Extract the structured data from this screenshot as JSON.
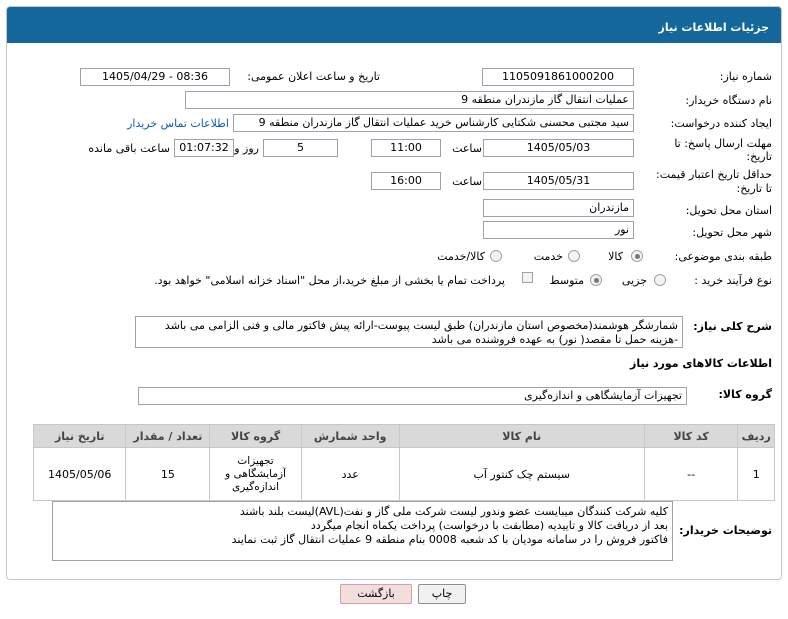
{
  "header": {
    "title": "جزئیات اطلاعات نیاز"
  },
  "form": {
    "need_number_label": "شماره نیاز:",
    "need_number": "1105091861000200",
    "announce_label": "تاریخ و ساعت اعلان عمومی:",
    "announce_value": "1405/04/29 - 08:36",
    "buyer_org_label": "نام دستگاه خریدار:",
    "buyer_org": "عملیات انتقال گاز مازندران منطقه 9",
    "requester_label": "ایجاد کننده درخواست:",
    "requester": "سید مجتبی محسنی شکتایی کارشناس خرید عملیات انتقال گاز مازندران منطقه 9",
    "contact_link": "اطلاعات تماس خریدار",
    "deadline_label_1": "مهلت ارسال پاسخ: تا",
    "deadline_label_2": "تاریخ:",
    "deadline_date": "1405/05/03",
    "time_label": "ساعت",
    "deadline_time": "11:00",
    "days_value": "5",
    "days_label": "روز و",
    "remaining_time": "01:07:32",
    "remaining_label": "ساعت باقی مانده",
    "price_label_1": "حداقل تاریخ اعتبار قیمت:",
    "price_label_2": "تا تاریخ:",
    "price_date": "1405/05/31",
    "price_time": "16:00",
    "province_label": "استان محل تحویل:",
    "province": "مازندران",
    "city_label": "شهر محل تحویل:",
    "city": "نور",
    "category_label": "طبقه بندی موضوعی:",
    "category_options": [
      "کالا",
      "خدمت",
      "کالا/خدمت"
    ],
    "process_label": "نوع فرآیند خرید :",
    "process_options": [
      "جزیی",
      "متوسط"
    ],
    "payment_note": "پرداخت تمام یا بخشی از مبلغ خرید،از محل \"اسناد خزانه اسلامی\" خواهد بود."
  },
  "summary": {
    "label": "شرح کلی نیاز:",
    "text": "شمارشگر هوشمند(مخصوص استان مازندران) طبق لیست پیوست-ارائه پیش فاکتور مالی و فنی الزامی می باشد -هزینه حمل تا مقصد( نور) به عهده فروشنده می باشد"
  },
  "goods_info_title": "اطلاعات کالاهای مورد نیاز",
  "goods_group": {
    "label": "گروه کالا:",
    "value": "تجهیزات آزمایشگاهی و اندازه‌گیری"
  },
  "table": {
    "headers": [
      "ردیف",
      "کد کالا",
      "نام کالا",
      "واحد شمارش",
      "گروه کالا",
      "تعداد / مقدار",
      "تاریخ نیاز"
    ],
    "rows": [
      {
        "row": "1",
        "code": "--",
        "name": "سیستم چک کنتور آب",
        "unit": "عدد",
        "group": "تجهیزات آزمایشگاهی و اندازه‌گیری",
        "qty": "15",
        "date": "1405/05/06"
      }
    ]
  },
  "buyer_notes": {
    "label": "توضیحات خریدار:",
    "lines": [
      "کلیه شرکت کنندگان میبایست عضو وندور لیست شرکت ملی گاز و نفت(AVL)لیست بلند باشند",
      "بعد از دریافت کالا و تاییدیه (مطابقت با درخواست) پرداخت یکماه انجام میگردد",
      "فاکتور فروش را در سامانه مودیان با کد شعبه 0008 بنام منطقه 9 عملیات انتقال گاز ثبت نمایند"
    ]
  },
  "buttons": {
    "print": "چاپ",
    "back": "بازگشت"
  }
}
